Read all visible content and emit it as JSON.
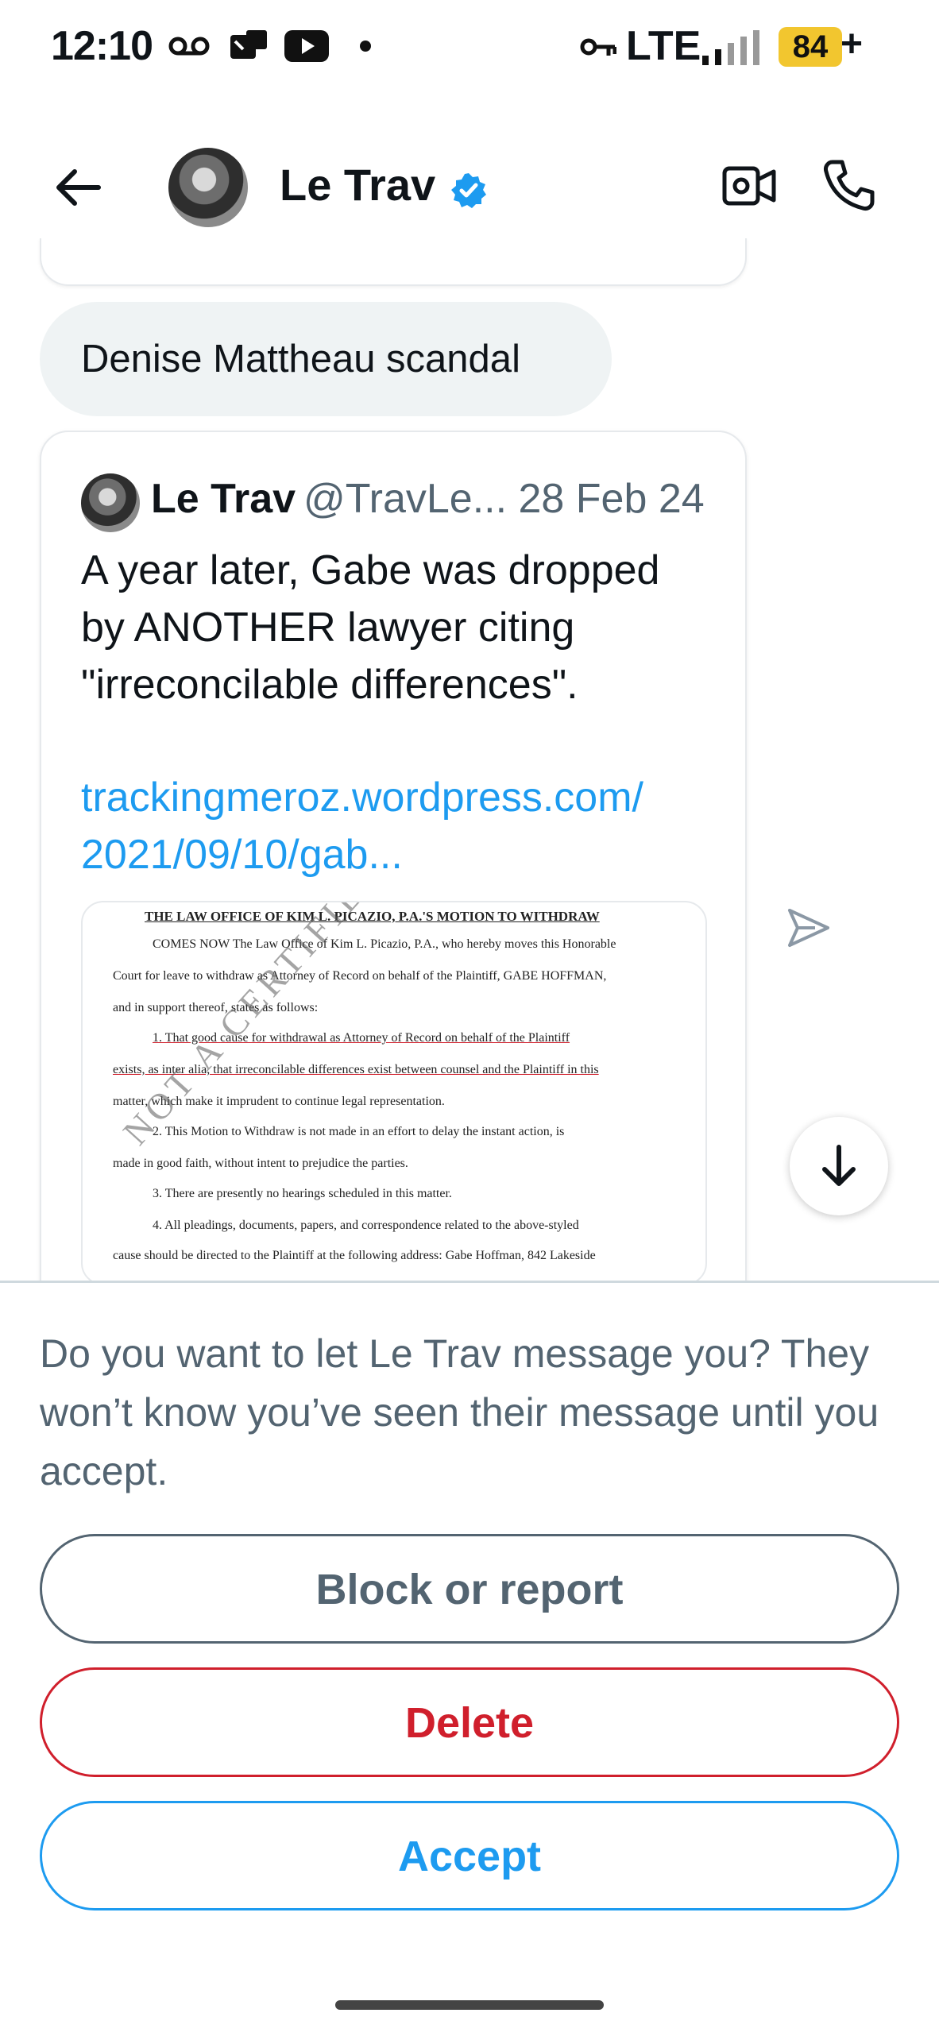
{
  "status_bar": {
    "time": "12:10",
    "network": "LTE",
    "battery": "84",
    "battery_suffix": "+",
    "icons": [
      "voicemail-icon",
      "missed-call-icon",
      "youtube-icon",
      "dot-icon",
      "vpn-key-icon",
      "signal-icon"
    ]
  },
  "header": {
    "name": "Le Trav",
    "verified": true,
    "icons": [
      "back-arrow-icon",
      "video-call-icon",
      "phone-icon"
    ]
  },
  "chat": {
    "message": "Denise Mattheau scandal",
    "tweet": {
      "author": "Le Trav",
      "handle_date": "@TravLe... 28 Feb 24",
      "text": "A year later, Gabe was dropped by ANOTHER lawyer citing \"irreconcilable differences\".",
      "link_line1": "trackingmeroz.wordpress.com/",
      "link_line2": "2021/09/10/gab...",
      "document": {
        "title": "THE LAW OFFICE OF KIM L. PICAZIO, P.A.'S MOTION TO WITHDRAW",
        "lines": [
          "COMES NOW The Law Office of Kim L. Picazio, P.A., who hereby moves this Honorable",
          "Court for leave to withdraw as Attorney of Record on behalf of the Plaintiff, GABE HOFFMAN,",
          "and in support thereof, states as follows:",
          "1.     That good cause for withdrawal as Attorney of Record on behalf of the Plaintiff",
          "exists, as inter alia, that irreconcilable differences exist between counsel and the Plaintiff in this",
          "matter, which make it imprudent to continue legal representation.",
          "2.     This Motion to Withdraw is not made in an effort to delay the instant action, is",
          "made in good faith, without intent to prejudice the parties.",
          "3.     There are presently no hearings scheduled in this matter.",
          "4.     All pleadings, documents, papers, and correspondence related to the above-styled",
          "cause should be directed to the Plaintiff at the following address: Gabe Hoffman, 842 Lakeside"
        ],
        "watermark": "NOT A CERTIFIED"
      }
    }
  },
  "request": {
    "prompt": "Do you want to let Le Trav message you? They won’t know you’ve seen their message until you accept.",
    "block_label": "Block or report",
    "delete_label": "Delete",
    "accept_label": "Accept"
  },
  "colors": {
    "accent": "#1d9bf0",
    "danger": "#d01f2c",
    "secondary_text": "#536471",
    "battery": "#f2c62f"
  }
}
